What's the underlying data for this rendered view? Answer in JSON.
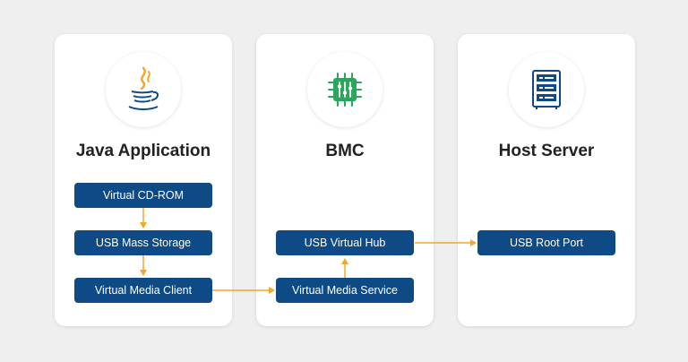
{
  "colors": {
    "box_fill": "#0e4a86",
    "arrow": "#f5a623",
    "java_icon": "#0e4a86",
    "chip": "#2aa75c",
    "server": "#0e4a86"
  },
  "cards": {
    "java": {
      "title": "Java Application",
      "icon": "java-logo-icon",
      "boxes": [
        "Virtual CD-ROM",
        "USB Mass Storage",
        "Virtual Media Client"
      ]
    },
    "bmc": {
      "title": "BMC",
      "icon": "chip-icon",
      "boxes": [
        "USB Virtual Hub",
        "Virtual Media Service"
      ]
    },
    "host": {
      "title": "Host Server",
      "icon": "server-rack-icon",
      "boxes": [
        "USB Root Port"
      ]
    }
  }
}
